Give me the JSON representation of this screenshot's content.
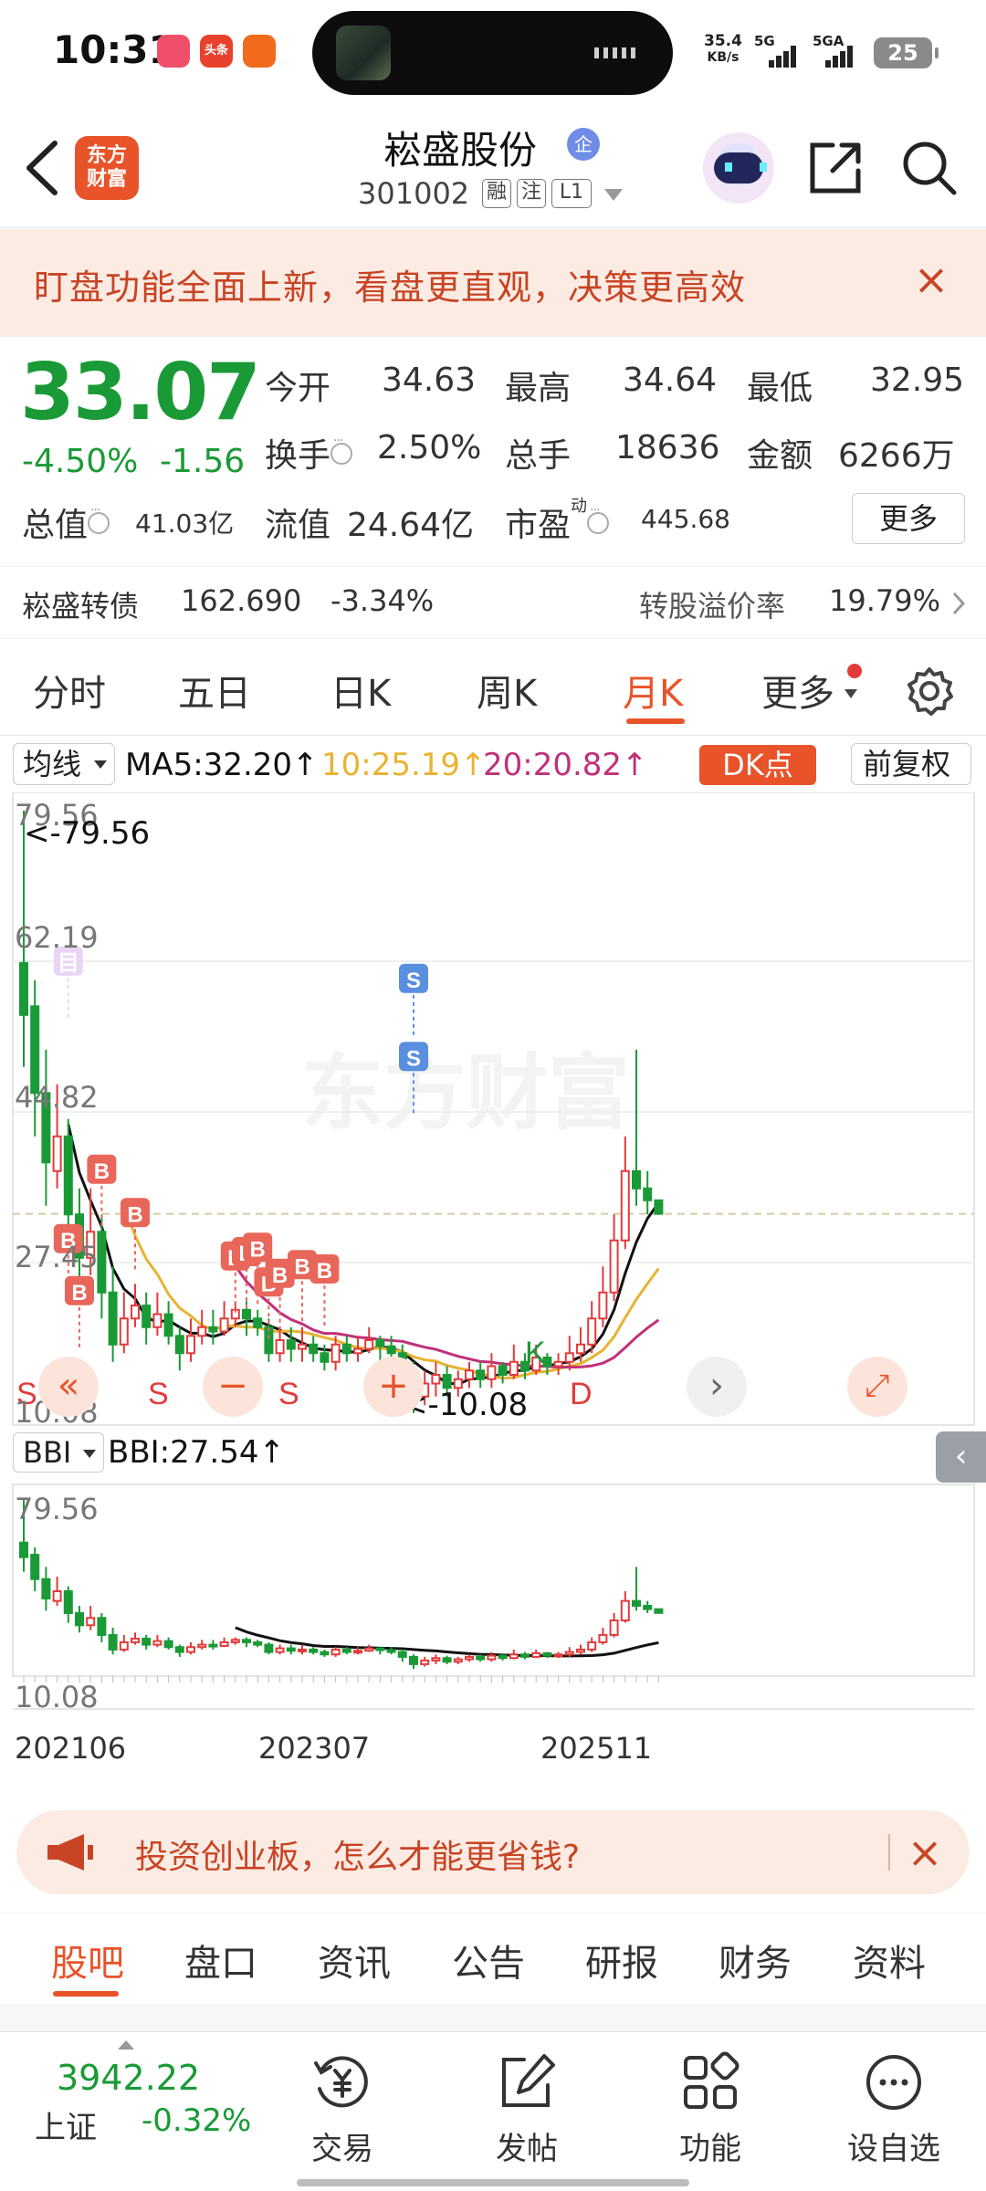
{
  "status_bar": {
    "time": "10:31",
    "net_speed": "35.4",
    "net_unit": "KB/s",
    "sig1": "5G",
    "sig2": "5GA",
    "battery": "25",
    "notif_apps": [
      "app-1",
      "头条",
      "app-3"
    ]
  },
  "header": {
    "logo_text_1": "东方",
    "logo_text_2": "财富",
    "stock_name": "崧盛股份",
    "badge": "企",
    "stock_code": "301002",
    "tags": [
      "融",
      "注",
      "L1"
    ]
  },
  "banner": {
    "text": "盯盘功能全面上新，看盘更直观，决策更高效",
    "close": "×"
  },
  "quote": {
    "price": "33.07",
    "change_pct": "-4.50%",
    "change": "-1.56",
    "open_label": "今开",
    "open": "34.63",
    "high_label": "最高",
    "high": "34.64",
    "low_label": "最低",
    "low": "32.95",
    "turnover_label": "换手",
    "turnover": "2.50%",
    "volume_label": "总手",
    "volume": "18636",
    "amount_label": "金额",
    "amount": "6266万",
    "mktcap_label": "总值",
    "mktcap": "41.03亿",
    "float_label": "流值",
    "float_cap": "24.64亿",
    "pe_label": "市盈",
    "pe_sup": "动",
    "pe": "445.68",
    "more_button": "更多"
  },
  "bond": {
    "name": "崧盛转债",
    "price": "162.690",
    "change": "-3.34%",
    "premium_label": "转股溢价率",
    "premium": "19.79%"
  },
  "period_tabs": [
    "分时",
    "五日",
    "日K",
    "周K",
    "月K",
    "更多"
  ],
  "active_period": "月K",
  "indicators": {
    "ma_select": "均线",
    "ma5": "MA5:32.20↑",
    "ma10": "10:25.19↑",
    "ma20": "20:20.82↑",
    "dk_button": "DK点",
    "adjust": "前复权",
    "sub_select": "BBI",
    "bbi": "BBI:27.54↑"
  },
  "chart_data": {
    "type": "candlestick",
    "axis_labels": [
      "79.56",
      "62.19",
      "44.82",
      "27.45",
      "10.08"
    ],
    "high_marker": "<-79.56",
    "low_marker": "<-10.08",
    "ylim": [
      10.08,
      79.56
    ],
    "sub_axis_labels": [
      "79.56",
      "10.08"
    ],
    "date_labels": [
      "202106",
      "202307",
      "202511"
    ],
    "markers": {
      "buy": "B",
      "sell": "S",
      "watch": "目",
      "kline": "K",
      "d": "D"
    },
    "colors": {
      "up": "#e23b3b",
      "down": "#1a9a36",
      "ma5": "#111111",
      "ma10": "#e8b331",
      "ma20": "#c0307a"
    },
    "candles": [
      {
        "o": 62,
        "c": 56,
        "h": 79.56,
        "l": 50
      },
      {
        "o": 57,
        "c": 47,
        "h": 60,
        "l": 42
      },
      {
        "o": 47,
        "c": 39,
        "h": 52,
        "l": 34
      },
      {
        "o": 38,
        "c": 42,
        "h": 48,
        "l": 36
      },
      {
        "o": 42,
        "c": 33,
        "h": 44,
        "l": 29
      },
      {
        "o": 33,
        "c": 28,
        "h": 36,
        "l": 25
      },
      {
        "o": 28,
        "c": 31,
        "h": 36,
        "l": 26
      },
      {
        "o": 31,
        "c": 24,
        "h": 33,
        "l": 21
      },
      {
        "o": 24,
        "c": 18,
        "h": 27,
        "l": 16
      },
      {
        "o": 18,
        "c": 21,
        "h": 24,
        "l": 17
      },
      {
        "o": 21,
        "c": 22.5,
        "h": 25,
        "l": 20
      },
      {
        "o": 22.5,
        "c": 20,
        "h": 24,
        "l": 18
      },
      {
        "o": 20,
        "c": 21.5,
        "h": 24,
        "l": 19
      },
      {
        "o": 21.5,
        "c": 19,
        "h": 23,
        "l": 18
      },
      {
        "o": 19,
        "c": 17,
        "h": 20,
        "l": 15
      },
      {
        "o": 17,
        "c": 19,
        "h": 21,
        "l": 16
      },
      {
        "o": 19,
        "c": 20,
        "h": 22,
        "l": 18
      },
      {
        "o": 20,
        "c": 19.5,
        "h": 22,
        "l": 18
      },
      {
        "o": 19.5,
        "c": 21,
        "h": 23,
        "l": 19
      },
      {
        "o": 21,
        "c": 22,
        "h": 23,
        "l": 20
      },
      {
        "o": 22,
        "c": 21,
        "h": 23,
        "l": 19
      },
      {
        "o": 21,
        "c": 20,
        "h": 22,
        "l": 19
      },
      {
        "o": 20,
        "c": 17,
        "h": 21,
        "l": 16
      },
      {
        "o": 17,
        "c": 18.5,
        "h": 20,
        "l": 16
      },
      {
        "o": 18.5,
        "c": 17.5,
        "h": 20,
        "l": 16
      },
      {
        "o": 17.5,
        "c": 18,
        "h": 20,
        "l": 16
      },
      {
        "o": 18,
        "c": 17,
        "h": 19,
        "l": 16
      },
      {
        "o": 17,
        "c": 16,
        "h": 18,
        "l": 15
      },
      {
        "o": 16,
        "c": 18,
        "h": 19,
        "l": 15
      },
      {
        "o": 18,
        "c": 17,
        "h": 19,
        "l": 16
      },
      {
        "o": 17,
        "c": 17.5,
        "h": 19,
        "l": 16
      },
      {
        "o": 17.5,
        "c": 18.5,
        "h": 20,
        "l": 17
      },
      {
        "o": 18.5,
        "c": 17.8,
        "h": 19,
        "l": 16
      },
      {
        "o": 17.8,
        "c": 17,
        "h": 19,
        "l": 16
      },
      {
        "o": 17,
        "c": 15,
        "h": 18,
        "l": 13
      },
      {
        "o": 15,
        "c": 12,
        "h": 16,
        "l": 10.08
      },
      {
        "o": 12,
        "c": 13.5,
        "h": 15,
        "l": 11
      },
      {
        "o": 13.5,
        "c": 14.5,
        "h": 16,
        "l": 12
      },
      {
        "o": 14.5,
        "c": 13,
        "h": 15.5,
        "l": 12
      },
      {
        "o": 13,
        "c": 14,
        "h": 15,
        "l": 12
      },
      {
        "o": 14,
        "c": 15,
        "h": 16,
        "l": 13
      },
      {
        "o": 15,
        "c": 14,
        "h": 16,
        "l": 13
      },
      {
        "o": 14,
        "c": 15.5,
        "h": 17,
        "l": 13
      },
      {
        "o": 15.5,
        "c": 14.5,
        "h": 16,
        "l": 13.5
      },
      {
        "o": 14.5,
        "c": 16,
        "h": 18,
        "l": 14
      },
      {
        "o": 16,
        "c": 15,
        "h": 17,
        "l": 14
      },
      {
        "o": 15,
        "c": 16.5,
        "h": 18,
        "l": 14.5
      },
      {
        "o": 16.5,
        "c": 15.5,
        "h": 17,
        "l": 14.5
      },
      {
        "o": 15.5,
        "c": 16,
        "h": 17,
        "l": 14.5
      },
      {
        "o": 16,
        "c": 17,
        "h": 19,
        "l": 15
      },
      {
        "o": 17,
        "c": 18,
        "h": 20,
        "l": 16
      },
      {
        "o": 18,
        "c": 21,
        "h": 23,
        "l": 17
      },
      {
        "o": 21,
        "c": 24,
        "h": 27,
        "l": 20
      },
      {
        "o": 24,
        "c": 30,
        "h": 33,
        "l": 23
      },
      {
        "o": 30,
        "c": 38,
        "h": 42,
        "l": 29
      },
      {
        "o": 38,
        "c": 36,
        "h": 52,
        "l": 34
      },
      {
        "o": 36,
        "c": 34.63,
        "h": 38,
        "l": 33
      },
      {
        "o": 34.63,
        "c": 33.07,
        "h": 34.64,
        "l": 32.95
      }
    ]
  },
  "promo": {
    "text": "投资创业板，怎么才能更省钱?",
    "close": "×"
  },
  "info_tabs": [
    "股吧",
    "盘口",
    "资讯",
    "公告",
    "研报",
    "财务",
    "资料"
  ],
  "active_info_tab": "股吧",
  "bottom_nav": {
    "index_value": "3942.22",
    "index_name": "上证",
    "index_pct": "-0.32%",
    "items": [
      "交易",
      "发帖",
      "功能",
      "设自选"
    ]
  }
}
